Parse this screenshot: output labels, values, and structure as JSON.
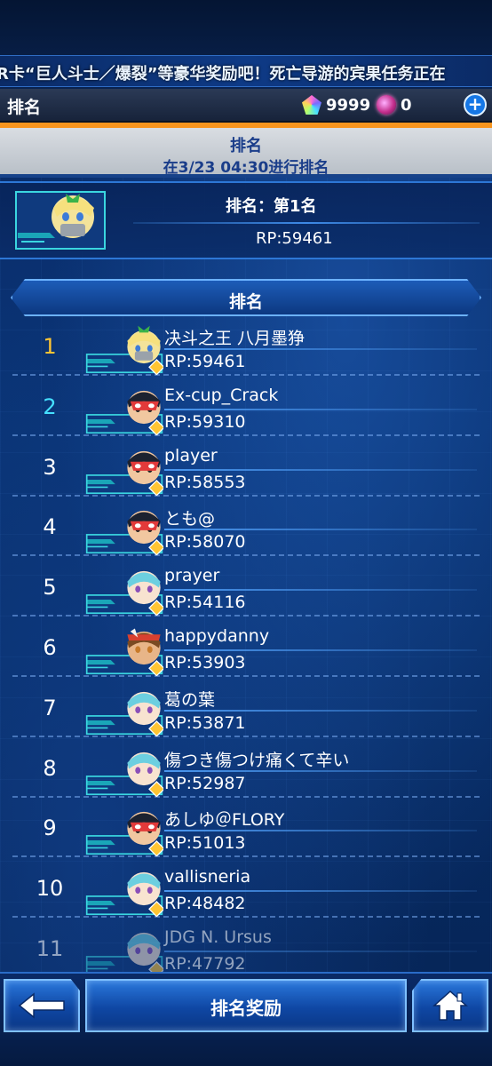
{
  "ticker": {
    "text": "R卡“巨人斗士／爆裂”等豪华奖励吧！死亡导游的宾果任务正在"
  },
  "header": {
    "title": "排名",
    "gems": "9999",
    "orbs": "0",
    "plus_icon": "plus-icon"
  },
  "banner": {
    "title": "排名",
    "subtitle": "在3/23 04:30进行排名"
  },
  "my_rank": {
    "rank": "排名：第1名",
    "rp": "RP:59461"
  },
  "list": {
    "heading": "排名",
    "rows": [
      {
        "rank": "1",
        "name": "决斗之王 八月墨狰",
        "rp": "RP:59461",
        "avatar": "green-hair"
      },
      {
        "rank": "2",
        "name": "Ex-cup_Crack",
        "rp": "RP:59310",
        "avatar": "red-mask"
      },
      {
        "rank": "3",
        "name": "player",
        "rp": "RP:58553",
        "avatar": "red-mask"
      },
      {
        "rank": "4",
        "name": "とも@",
        "rp": "RP:58070",
        "avatar": "red-mask"
      },
      {
        "rank": "5",
        "name": "prayer",
        "rp": "RP:54116",
        "avatar": "teal-hair"
      },
      {
        "rank": "6",
        "name": "happydanny",
        "rp": "RP:53903",
        "avatar": "brown-hair"
      },
      {
        "rank": "7",
        "name": "葛の葉",
        "rp": "RP:53871",
        "avatar": "teal-hair"
      },
      {
        "rank": "8",
        "name": "傷つき傷つけ痛くて辛い",
        "rp": "RP:52987",
        "avatar": "teal-hair"
      },
      {
        "rank": "9",
        "name": "あしゆ＠FLORY",
        "rp": "RP:51013",
        "avatar": "red-mask"
      },
      {
        "rank": "10",
        "name": "vallisneria",
        "rp": "RP:48482",
        "avatar": "teal-hair"
      },
      {
        "rank": "11",
        "name": "JDG N. Ursus",
        "rp": "RP:47792",
        "avatar": "teal-hair"
      }
    ]
  },
  "bottom": {
    "reward_label": "排名奖励",
    "back_icon": "back-arrow-icon",
    "home_icon": "home-icon"
  },
  "colors": {
    "accent_orange": "#f7941d",
    "rank_gold": "#ffc533",
    "rank_cyan": "#45e0ff",
    "button_blue": "#1a5fc4"
  }
}
